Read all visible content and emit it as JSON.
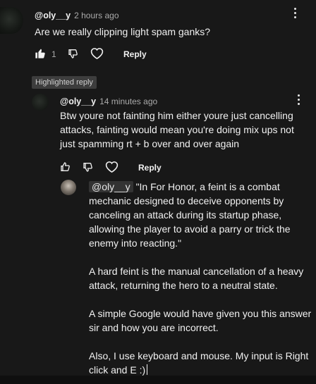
{
  "comment": {
    "handle": "@oly__y",
    "time": "2 hours ago",
    "text": "Are we really clipping light spam ganks?",
    "like_count": "1",
    "reply_label": "Reply"
  },
  "highlighted_label": "Highlighted reply",
  "reply": {
    "handle": "@oly__y",
    "time": "14 minutes ago",
    "lines": [
      "Btw youre not fainting him either youre just cancelling",
      "attacks, fainting would mean you're doing mix ups not",
      "just spamming rt + b over and over again"
    ],
    "reply_label": "Reply"
  },
  "compose": {
    "mention": "@oly__y",
    "paragraphs": [
      {
        "lines": [
          " \"In For Honor, a feint is a combat",
          "mechanic designed to deceive opponents by",
          "canceling an attack during its startup phase,",
          "allowing the player to avoid a parry or trick the",
          "enemy into reacting.\""
        ]
      },
      {
        "lines": [
          "A hard feint is the manual cancellation of a heavy",
          "attack, returning the hero to a neutral state."
        ]
      },
      {
        "lines": [
          "A simple Google would have given you this answer",
          "sir and how you are incorrect."
        ]
      },
      {
        "lines": [
          "Also, I use keyboard and mouse. My input is Right",
          "click and E :)"
        ]
      }
    ]
  },
  "icons": {
    "like": "thumbs-up-icon",
    "dislike": "thumbs-down-icon",
    "heart": "heart-icon",
    "menu": "vertical-ellipsis-icon"
  }
}
